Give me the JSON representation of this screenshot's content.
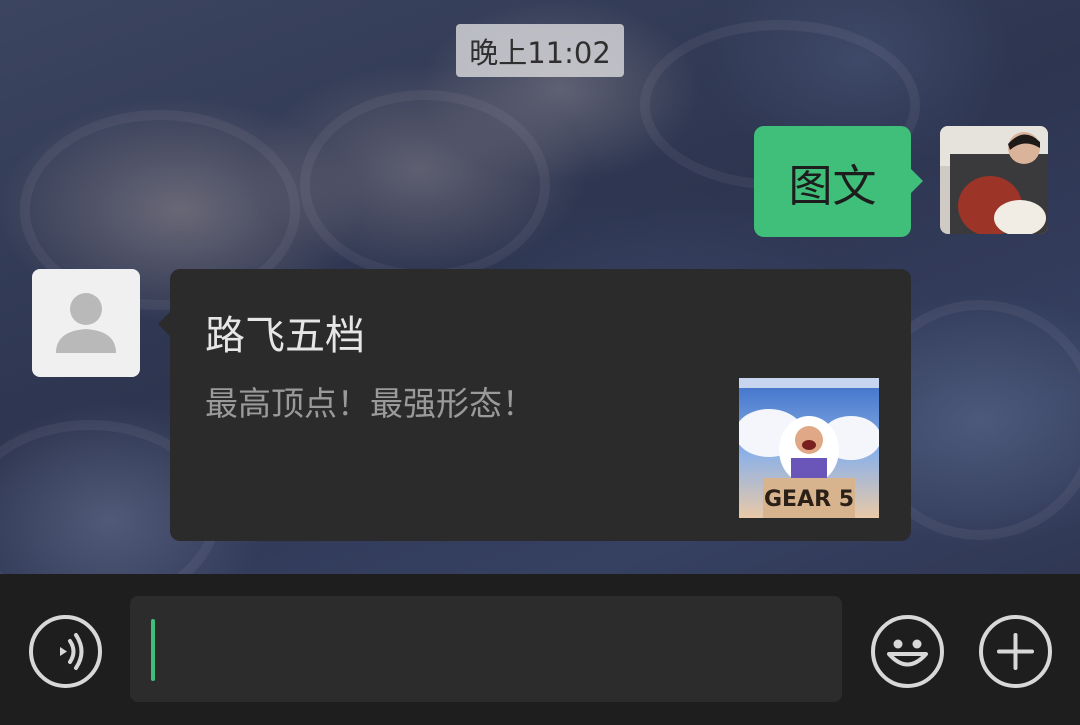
{
  "chat": {
    "timestamp": "晚上11:02",
    "messages": [
      {
        "sender": "me",
        "text": "图文"
      },
      {
        "sender": "other",
        "type": "link_card",
        "title": "路飞五档",
        "description": "最高顶点！最强形态！",
        "thumbnail_text": "GEAR 5"
      }
    ]
  },
  "input_bar": {
    "value": "",
    "icons": [
      "voice-icon",
      "emoji-icon",
      "plus-icon"
    ]
  },
  "colors": {
    "accent_green": "#3fbf7a",
    "card_bg": "#2b2b2b",
    "bar_bg": "#1e1e1e"
  }
}
